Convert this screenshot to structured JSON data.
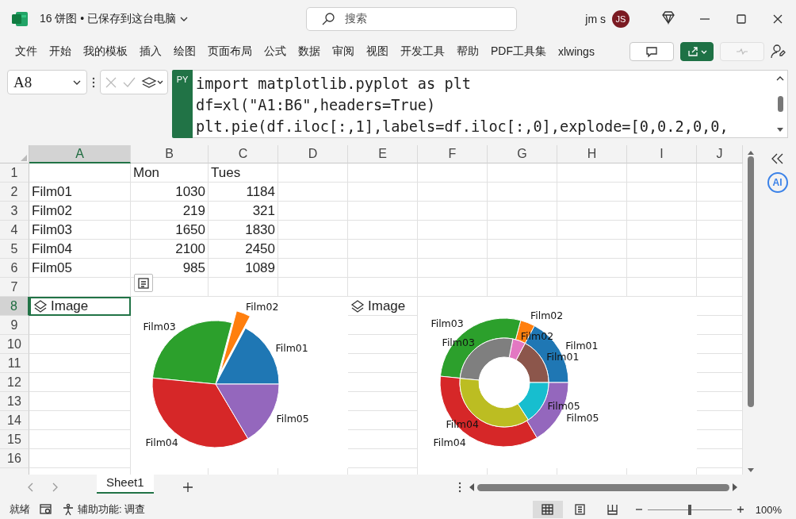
{
  "title_bar": {
    "file_title": "16 饼图 • 已保存到这台电脑",
    "search_placeholder": "搜索",
    "user_name": "jm s",
    "avatar_initials": "JS"
  },
  "ribbon_tabs": [
    "文件",
    "开始",
    "我的模板",
    "插入",
    "绘图",
    "页面布局",
    "公式",
    "数据",
    "审阅",
    "视图",
    "开发工具",
    "帮助",
    "PDF工具集",
    "xlwings"
  ],
  "formula_bar": {
    "name_box": "A8",
    "badge": "PY",
    "code_lines": [
      "import matplotlib.pyplot as plt",
      "df=xl(\"A1:B6\",headers=True)",
      "plt.pie(df.iloc[:,1],labels=df.iloc[:,0],explode=[0,0.2,0,0,"
    ]
  },
  "sheet": {
    "columns": [
      {
        "label": "A",
        "selected": true
      },
      {
        "label": "B",
        "selected": false
      },
      {
        "label": "C",
        "selected": false
      },
      {
        "label": "D",
        "selected": false
      },
      {
        "label": "E",
        "selected": false
      },
      {
        "label": "F",
        "selected": false
      },
      {
        "label": "G",
        "selected": false
      },
      {
        "label": "H",
        "selected": false
      },
      {
        "label": "I",
        "selected": false
      },
      {
        "label": "J",
        "selected": false
      }
    ],
    "rows": [
      {
        "number": "1",
        "selected": false,
        "cells": {
          "B": {
            "text": "Mon",
            "kind": "text",
            "selected": false
          },
          "C": {
            "text": "Tues",
            "kind": "text",
            "selected": false
          }
        }
      },
      {
        "number": "2",
        "selected": false,
        "cells": {
          "A": {
            "text": "Film01",
            "kind": "text",
            "selected": false
          },
          "B": {
            "text": "1030",
            "kind": "number",
            "selected": false
          },
          "C": {
            "text": "1184",
            "kind": "number",
            "selected": false
          }
        }
      },
      {
        "number": "3",
        "selected": false,
        "cells": {
          "A": {
            "text": "Film02",
            "kind": "text",
            "selected": false
          },
          "B": {
            "text": "219",
            "kind": "number",
            "selected": false
          },
          "C": {
            "text": "321",
            "kind": "number",
            "selected": false
          }
        }
      },
      {
        "number": "4",
        "selected": false,
        "cells": {
          "A": {
            "text": "Film03",
            "kind": "text",
            "selected": false
          },
          "B": {
            "text": "1650",
            "kind": "number",
            "selected": false
          },
          "C": {
            "text": "1830",
            "kind": "number",
            "selected": false
          }
        }
      },
      {
        "number": "5",
        "selected": false,
        "cells": {
          "A": {
            "text": "Film04",
            "kind": "text",
            "selected": false
          },
          "B": {
            "text": "2100",
            "kind": "number",
            "selected": false
          },
          "C": {
            "text": "2450",
            "kind": "number",
            "selected": false
          }
        }
      },
      {
        "number": "6",
        "selected": false,
        "cells": {
          "A": {
            "text": "Film05",
            "kind": "text",
            "selected": false
          },
          "B": {
            "text": "985",
            "kind": "number",
            "selected": false
          },
          "C": {
            "text": "1089",
            "kind": "number",
            "selected": false
          }
        }
      },
      {
        "number": "7",
        "selected": false,
        "cells": {}
      },
      {
        "number": "8",
        "selected": true,
        "cells": {
          "A": {
            "text": "Image",
            "kind": "image_ref",
            "selected": true
          },
          "E": {
            "text": "Image",
            "kind": "image_ref",
            "selected": false
          }
        }
      },
      {
        "number": "9",
        "selected": false,
        "cells": {}
      },
      {
        "number": "10",
        "selected": false,
        "cells": {}
      },
      {
        "number": "11",
        "selected": false,
        "cells": {}
      },
      {
        "number": "12",
        "selected": false,
        "cells": {}
      },
      {
        "number": "13",
        "selected": false,
        "cells": {}
      },
      {
        "number": "14",
        "selected": false,
        "cells": {}
      },
      {
        "number": "15",
        "selected": false,
        "cells": {}
      },
      {
        "number": "16",
        "selected": false,
        "cells": {}
      }
    ],
    "images": [
      {
        "kind": "pie_picture",
        "labels": [
          "Film01",
          "Film02",
          "Film03",
          "Film04",
          "Film05"
        ]
      },
      {
        "kind": "chart",
        "chart_data": {
          "type": "donut",
          "categories": [
            "Film01",
            "Film02",
            "Film03",
            "Film04",
            "Film05"
          ],
          "series": [
            {
              "values": [
                17.21,
                3.66,
                27.57,
                35.09,
                16.47
              ],
              "colors": [
                "#1f77b4",
                "#ff7f0e",
                "#2ca02c",
                "#d62728",
                "#9467bd"
              ]
            },
            {
              "values": [
                17.22,
                4.67,
                26.62,
                35.64,
                15.85
              ],
              "colors": [
                "#8c564b",
                "#e377c2",
                "#7f7f7f",
                "#bcbd22",
                "#17becf"
              ]
            }
          ],
          "annotations": [
            {
              "text": "Film01"
            },
            {
              "text": "Film02"
            },
            {
              "text": "Film03"
            },
            {
              "text": "Film04"
            },
            {
              "text": "Film05"
            }
          ]
        }
      }
    ]
  },
  "sheet_tabs": [
    {
      "label": "Sheet1",
      "selected": true
    }
  ],
  "side_panel": {
    "ai_label": "AI"
  },
  "status_bar": {
    "ready": "就绪",
    "accessibility": "辅助功能: 调查",
    "views": [
      {
        "kind": "normal",
        "selected": true
      },
      {
        "kind": "page_layout",
        "selected": false
      },
      {
        "kind": "page_break",
        "selected": false
      }
    ],
    "zoom": {
      "level": 0.5,
      "reading": "100%"
    }
  }
}
